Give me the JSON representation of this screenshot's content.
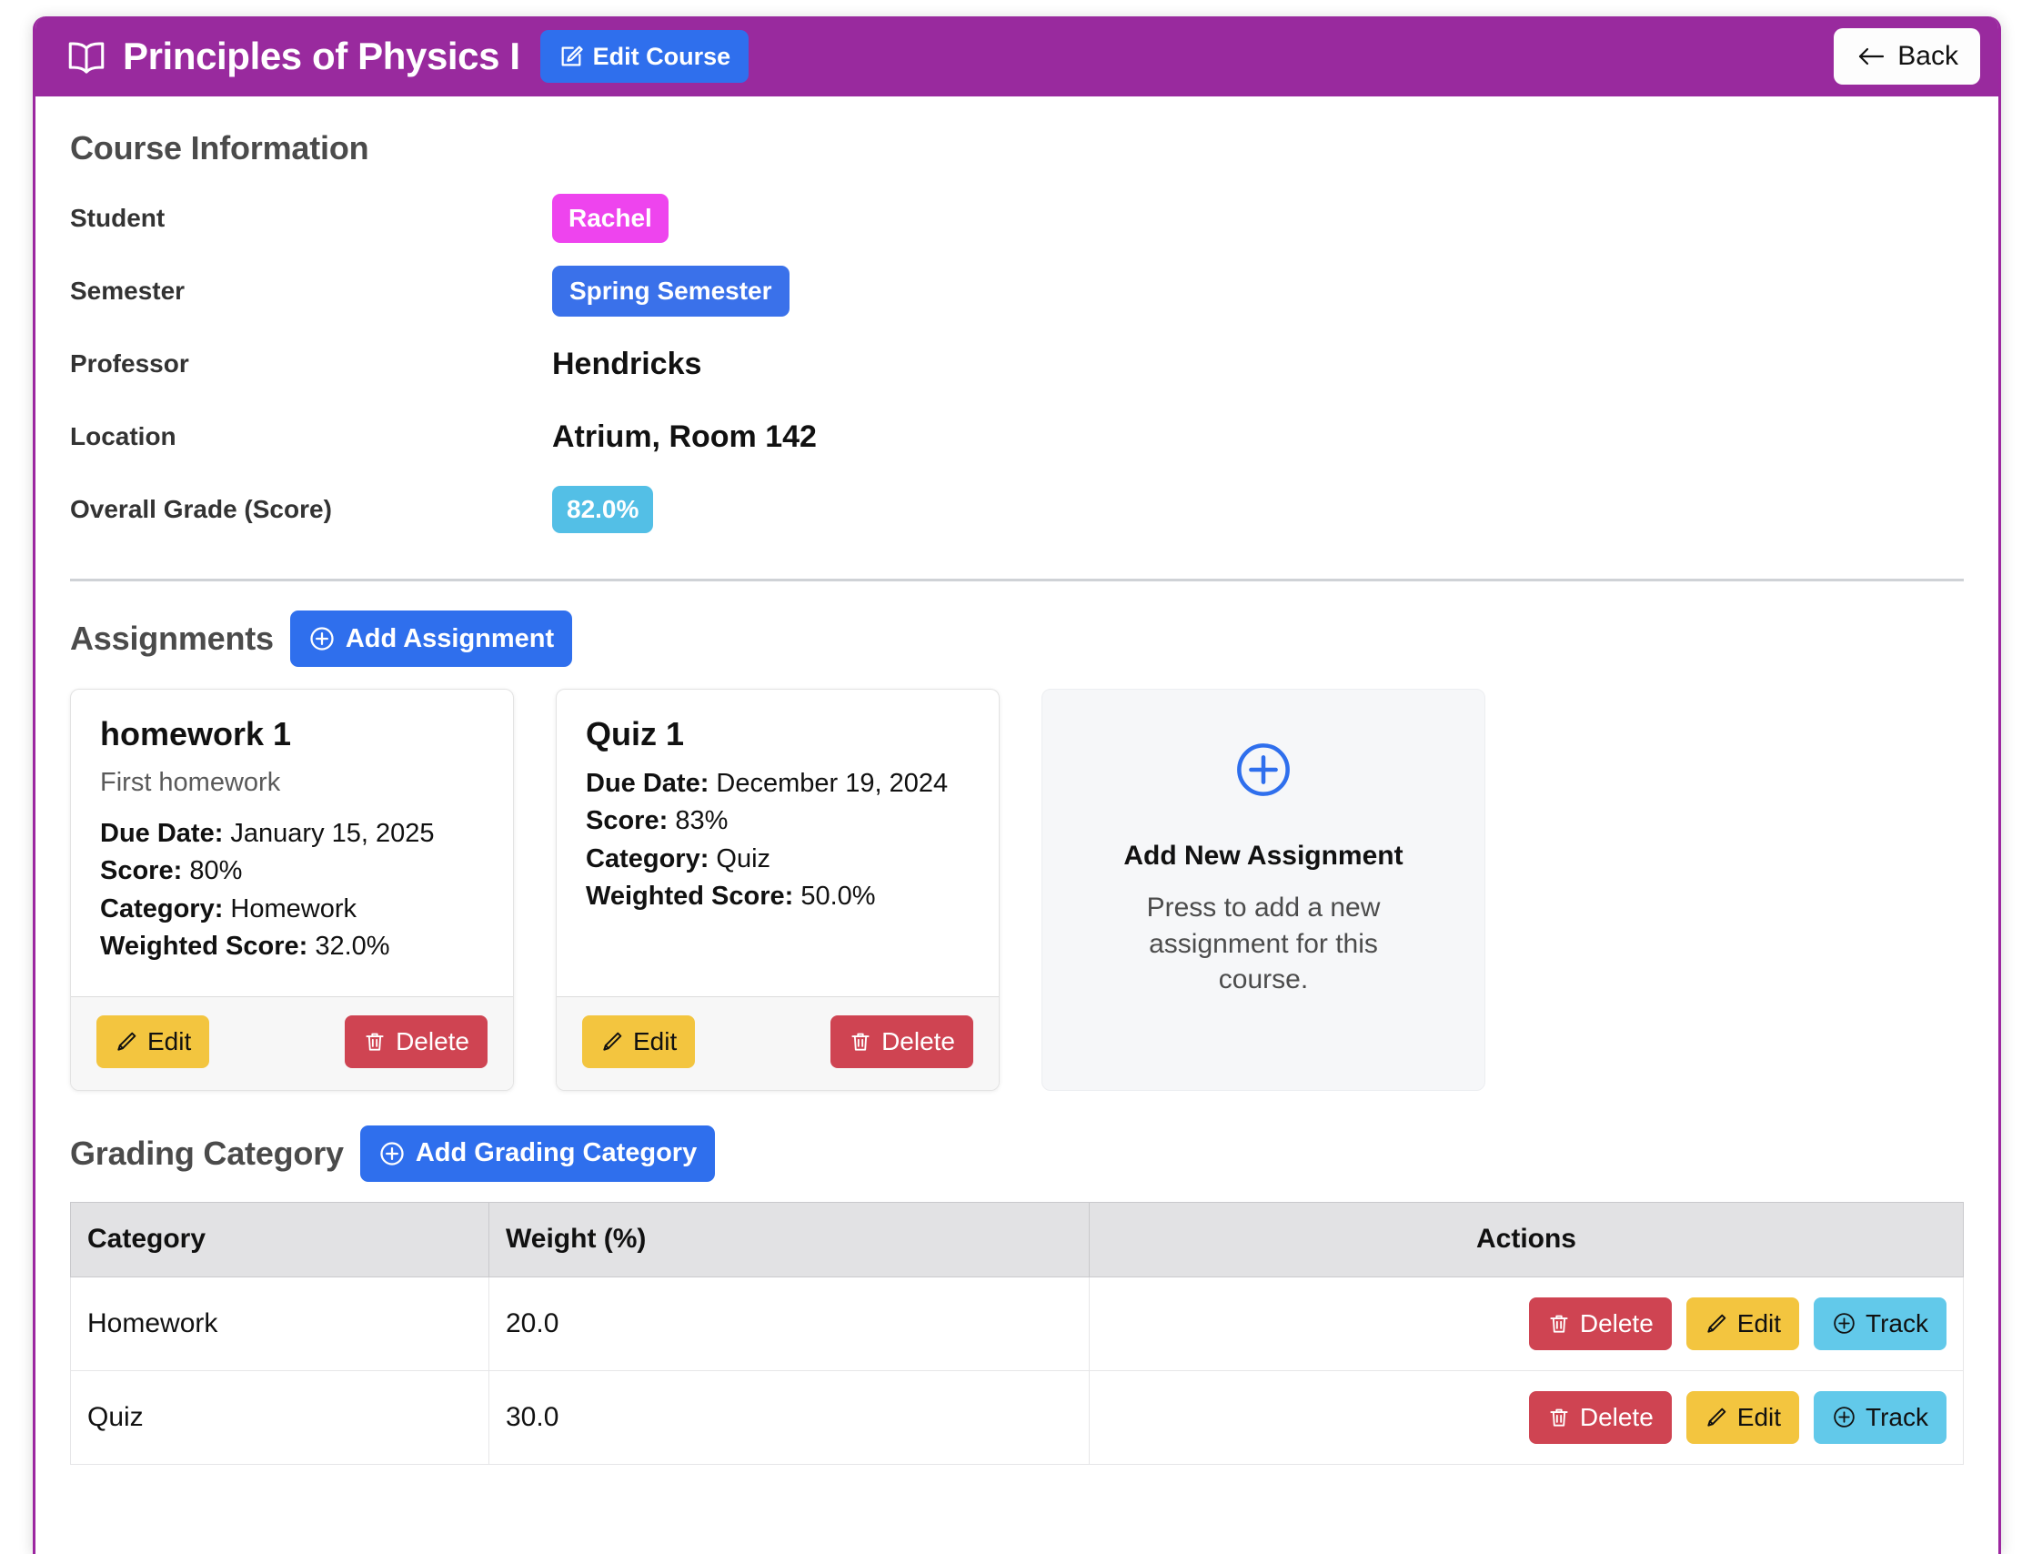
{
  "header": {
    "book_icon": "book-icon",
    "title": "Principles of Physics I",
    "edit_course_label": "Edit Course",
    "edit_icon": "edit-square-pencil-icon",
    "back_label": "Back",
    "back_icon": "arrow-left-icon",
    "bar_color": "#992a9e",
    "button_color": "#2f6fed"
  },
  "course_information": {
    "heading": "Course Information",
    "rows": [
      {
        "label": "Student",
        "value": "Rachel",
        "style": "badge-student",
        "color": "#ee44ee"
      },
      {
        "label": "Semester",
        "value": "Spring Semester",
        "style": "badge-semester",
        "color": "#3a71ea"
      },
      {
        "label": "Professor",
        "value": "Hendricks",
        "style": "plain",
        "color": "#111111"
      },
      {
        "label": "Location",
        "value": "Atrium, Room 142",
        "style": "plain",
        "color": "#111111"
      },
      {
        "label": "Overall Grade (Score)",
        "value": "82.0%",
        "style": "badge-grade",
        "color": "#53bfe6"
      }
    ]
  },
  "assignments": {
    "heading": "Assignments",
    "add_button_label": "Add Assignment",
    "add_button_icon": "plus-circle-icon",
    "labels": {
      "due_date": "Due Date:",
      "score": "Score:",
      "category": "Category:",
      "weighted_score": "Weighted Score:",
      "edit": "Edit",
      "delete": "Delete",
      "edit_icon": "pencil-icon",
      "delete_icon": "trash-icon"
    },
    "cards": [
      {
        "title": "homework 1",
        "description": "First homework",
        "due_date": "January 15, 2025",
        "score": "80%",
        "category": "Homework",
        "weighted_score": "32.0%"
      },
      {
        "title": "Quiz 1",
        "description": "",
        "due_date": "December 19, 2024",
        "score": "83%",
        "category": "Quiz",
        "weighted_score": "50.0%"
      }
    ],
    "add_card": {
      "icon": "plus-circle-outline-icon",
      "title": "Add New Assignment",
      "subtitle": "Press to add a new assignment for this course."
    }
  },
  "grading_category": {
    "heading": "Grading Category",
    "add_button_label": "Add Grading Category",
    "add_button_icon": "plus-circle-icon",
    "columns": [
      "Category",
      "Weight (%)",
      "Actions"
    ],
    "row_action_labels": {
      "delete": "Delete",
      "edit": "Edit",
      "track": "Track",
      "delete_icon": "trash-icon",
      "edit_icon": "pencil-icon",
      "track_icon": "plus-circle-icon"
    },
    "rows": [
      {
        "category": "Homework",
        "weight": "20.0"
      },
      {
        "category": "Quiz",
        "weight": "30.0"
      }
    ]
  }
}
